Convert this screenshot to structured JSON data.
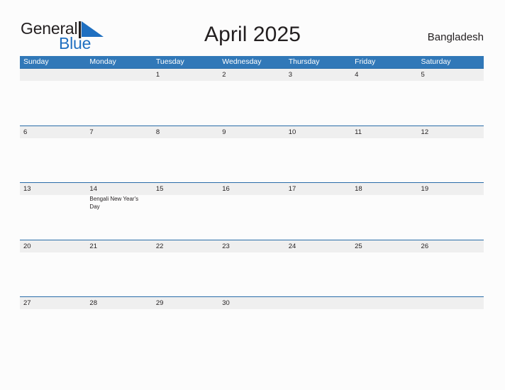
{
  "brand": {
    "name_part1": "General",
    "name_part2": "Blue",
    "flag_icon": "blue-flag-triangle-icon",
    "color_primary": "#1f6fc0",
    "color_text": "#231f20"
  },
  "header": {
    "title": "April 2025",
    "country": "Bangladesh"
  },
  "calendar": {
    "month": "April",
    "year": "2025",
    "header_bg": "#3178b8",
    "strip_bg": "#efefef",
    "rule_color": "#2a6ca8",
    "weekday_headers": [
      "Sunday",
      "Monday",
      "Tuesday",
      "Wednesday",
      "Thursday",
      "Friday",
      "Saturday"
    ],
    "weeks": [
      {
        "days": [
          {
            "num": "",
            "events": []
          },
          {
            "num": "",
            "events": []
          },
          {
            "num": "1",
            "events": []
          },
          {
            "num": "2",
            "events": []
          },
          {
            "num": "3",
            "events": []
          },
          {
            "num": "4",
            "events": []
          },
          {
            "num": "5",
            "events": []
          }
        ]
      },
      {
        "days": [
          {
            "num": "6",
            "events": []
          },
          {
            "num": "7",
            "events": []
          },
          {
            "num": "8",
            "events": []
          },
          {
            "num": "9",
            "events": []
          },
          {
            "num": "10",
            "events": []
          },
          {
            "num": "11",
            "events": []
          },
          {
            "num": "12",
            "events": []
          }
        ]
      },
      {
        "days": [
          {
            "num": "13",
            "events": []
          },
          {
            "num": "14",
            "events": [
              "Bengali New Year's Day"
            ]
          },
          {
            "num": "15",
            "events": []
          },
          {
            "num": "16",
            "events": []
          },
          {
            "num": "17",
            "events": []
          },
          {
            "num": "18",
            "events": []
          },
          {
            "num": "19",
            "events": []
          }
        ]
      },
      {
        "days": [
          {
            "num": "20",
            "events": []
          },
          {
            "num": "21",
            "events": []
          },
          {
            "num": "22",
            "events": []
          },
          {
            "num": "23",
            "events": []
          },
          {
            "num": "24",
            "events": []
          },
          {
            "num": "25",
            "events": []
          },
          {
            "num": "26",
            "events": []
          }
        ]
      },
      {
        "days": [
          {
            "num": "27",
            "events": []
          },
          {
            "num": "28",
            "events": []
          },
          {
            "num": "29",
            "events": []
          },
          {
            "num": "30",
            "events": []
          },
          {
            "num": "",
            "events": []
          },
          {
            "num": "",
            "events": []
          },
          {
            "num": "",
            "events": []
          }
        ]
      }
    ]
  }
}
